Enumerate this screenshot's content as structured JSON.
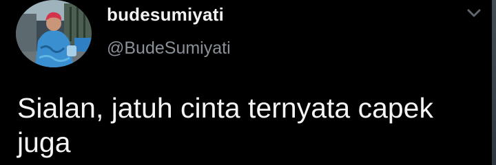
{
  "tweet": {
    "author": {
      "display_name": "budesumiyati",
      "handle": "@BudeSumiyati",
      "avatar_icon": "profile-photo"
    },
    "menu_icon": "chevron-down-icon",
    "text": "Sialan, jatuh cinta ternyata capek juga"
  },
  "colors": {
    "background": "#000000",
    "name": "#f2f2f2",
    "handle": "#8a9199",
    "text": "#f4f4f4"
  }
}
